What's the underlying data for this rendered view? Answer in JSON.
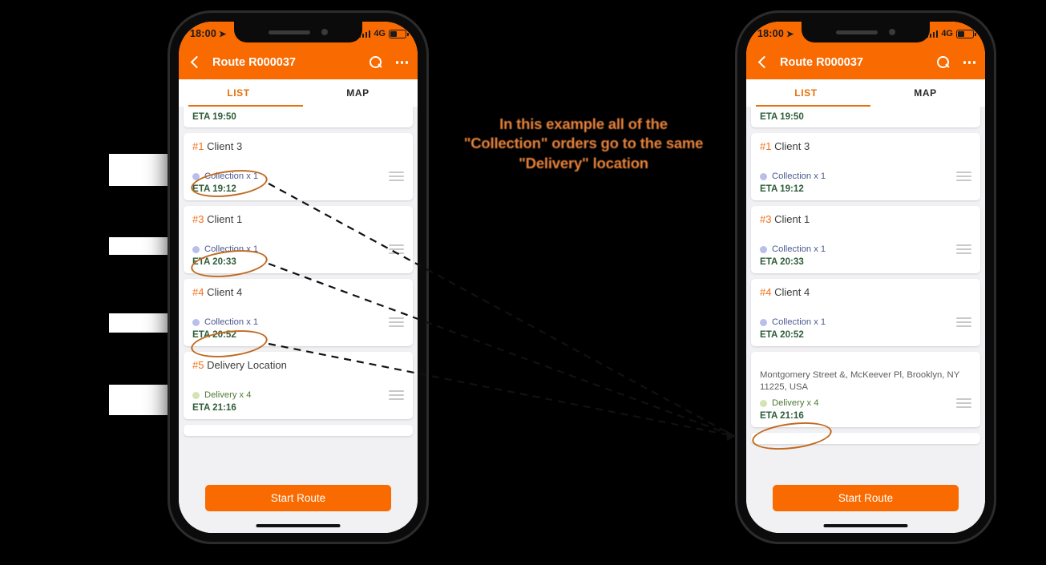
{
  "caption": "In this example all of the \"Collection\" orders go to the same \"Delivery\" location",
  "status_bar": {
    "time": "18:00",
    "location_icon": "location-arrow-icon",
    "network": "4G"
  },
  "app_bar": {
    "back_icon": "back-chevron-icon",
    "title": "Route R000037",
    "search_icon": "search-icon",
    "overflow_icon": "more-options-icon"
  },
  "tabs": [
    {
      "label": "LIST",
      "active": true
    },
    {
      "label": "MAP",
      "active": false
    }
  ],
  "footer": {
    "start_label": "Start Route"
  },
  "colors": {
    "brand_orange": "#F96A00",
    "accent_orange": "#E8700C",
    "collection_dot": "#b9bfea",
    "delivery_dot": "#d5e3b3",
    "eta_green": "#2f5d3a",
    "annotation": "#C1691F"
  },
  "left_phone": {
    "partial_top_eta": "ETA 19:50",
    "stops": [
      {
        "num": "#1",
        "name": "Client 3",
        "type_label": "Collection x 1",
        "type": "collection",
        "eta": "ETA 19:12",
        "handle_icon": "drag-handle-icon"
      },
      {
        "num": "#3",
        "name": "Client 1",
        "type_label": "Collection x 1",
        "type": "collection",
        "eta": "ETA 20:33",
        "handle_icon": "drag-handle-icon"
      },
      {
        "num": "#4",
        "name": "Client 4",
        "type_label": "Collection x 1",
        "type": "collection",
        "eta": "ETA 20:52",
        "handle_icon": "drag-handle-icon"
      },
      {
        "num": "#5",
        "name": "Delivery Location",
        "type_label": "Delivery x 4",
        "type": "delivery",
        "eta": "ETA 21:16",
        "handle_icon": "drag-handle-icon"
      }
    ]
  },
  "right_phone": {
    "partial_top_eta": "ETA 19:50",
    "stops": [
      {
        "num": "#1",
        "name": "Client 3",
        "type_label": "Collection x 1",
        "type": "collection",
        "eta": "ETA 19:12",
        "handle_icon": "drag-handle-icon"
      },
      {
        "num": "#3",
        "name": "Client 1",
        "type_label": "Collection x 1",
        "type": "collection",
        "eta": "ETA 20:33",
        "handle_icon": "drag-handle-icon"
      },
      {
        "num": "#4",
        "name": "Client 4",
        "type_label": "Collection x 1",
        "type": "collection",
        "eta": "ETA 20:52",
        "handle_icon": "drag-handle-icon"
      },
      {
        "address": "Montgomery Street &, McKeever Pl, Brooklyn, NY 11225, USA",
        "type_label": "Delivery x 4",
        "type": "delivery",
        "eta": "ETA 21:16",
        "handle_icon": "drag-handle-icon"
      }
    ]
  }
}
